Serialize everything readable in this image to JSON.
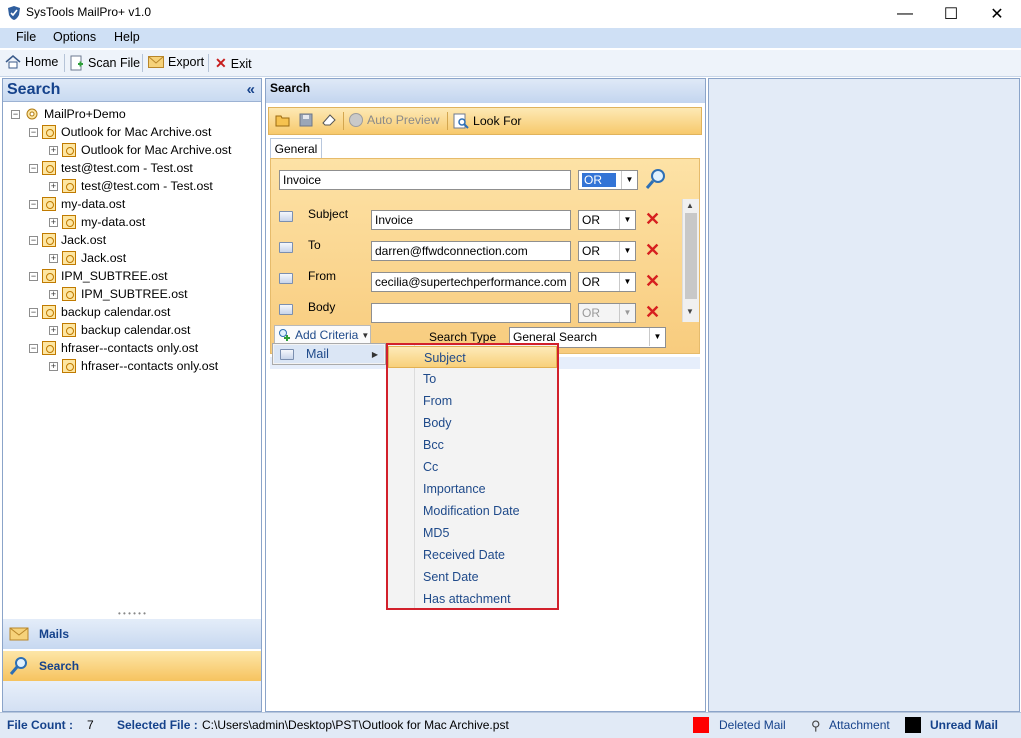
{
  "window": {
    "title": "SysTools MailPro+ v1.0",
    "minimize_glyph": "—",
    "maximize_glyph": "☐",
    "close_glyph": "✕"
  },
  "menu": [
    "File",
    "Options",
    "Help"
  ],
  "toolbar": {
    "home": "Home",
    "scan_file": "Scan File",
    "export": "Export",
    "exit": "Exit"
  },
  "left_panel": {
    "title": "Search",
    "collapse_glyph": "«",
    "root": "MailPro+Demo",
    "tree": [
      {
        "label": "Outlook for Mac Archive.ost",
        "child": "Outlook for Mac Archive.ost"
      },
      {
        "label": "test@test.com - Test.ost",
        "child": "test@test.com - Test.ost"
      },
      {
        "label": "my-data.ost",
        "child": "my-data.ost"
      },
      {
        "label": "Jack.ost",
        "child": "Jack.ost"
      },
      {
        "label": "IPM_SUBTREE.ost",
        "child": "IPM_SUBTREE.ost"
      },
      {
        "label": "backup calendar.ost",
        "child": "backup calendar.ost"
      },
      {
        "label": "hfraser--contacts only.ost",
        "child": "hfraser--contacts only.ost"
      }
    ],
    "nav": {
      "mails": "Mails",
      "search": "Search"
    }
  },
  "search_panel": {
    "title": "Search",
    "toolbar": {
      "auto_preview": "Auto Preview",
      "look_for": "Look For"
    },
    "tab": "General",
    "query_text": "Invoice",
    "query_operator": "OR",
    "criteria": [
      {
        "label": "Subject",
        "value": "Invoice",
        "operator": "OR"
      },
      {
        "label": "To",
        "value": "darren@ffwdconnection.com",
        "operator": "OR"
      },
      {
        "label": "From",
        "value": "cecilia@supertechperformance.com",
        "operator": "OR"
      },
      {
        "label": "Body",
        "value": "",
        "operator": "OR"
      }
    ],
    "add_criteria": "Add Criteria",
    "search_type_label": "Search Type",
    "search_type_value": "General Search"
  },
  "context_menu": {
    "mail": "Mail",
    "fields": [
      "Subject",
      "To",
      "From",
      "Body",
      "Bcc",
      "Cc",
      "Importance",
      "Modification Date",
      "MD5",
      "Received Date",
      "Sent Date",
      "Has attachment"
    ]
  },
  "status": {
    "file_count_label": "File Count :",
    "file_count": "7",
    "selected_file_label": "Selected File :",
    "selected_file": "C:\\Users\\admin\\Desktop\\PST\\Outlook for Mac Archive.pst",
    "deleted_mail": "Deleted Mail",
    "attachment": "Attachment",
    "unread_mail": "Unread Mail",
    "colors": {
      "deleted": "#ff0000",
      "unread": "#000000",
      "accent": "#15428b",
      "highlight": "#d2202b"
    }
  }
}
